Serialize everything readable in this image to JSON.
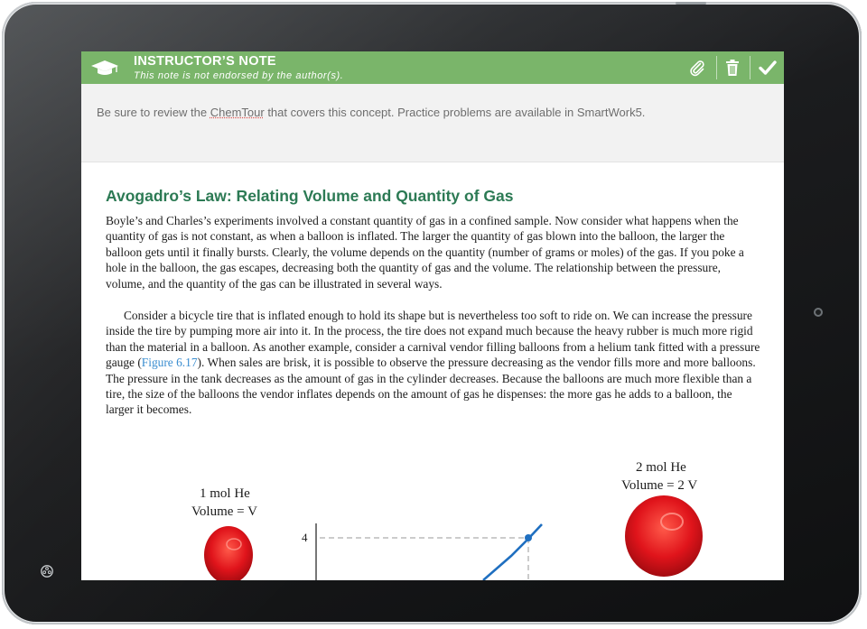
{
  "note": {
    "title": "INSTRUCTOR’S NOTE",
    "subtitle": "This note is not endorsed by the author(s).",
    "body_before": "Be sure to review the ",
    "body_link": "ChemTour",
    "body_after": " that covers this concept. Practice problems are available in SmartWork5.",
    "header_color": "#7ab56a",
    "icons": {
      "cap": "graduation-cap-icon",
      "attach": "paperclip-icon",
      "delete": "trash-icon",
      "confirm": "checkmark-icon"
    }
  },
  "section": {
    "heading": "Avogadro’s Law: Relating Volume and Quantity of Gas",
    "heading_color": "#2c7a54",
    "paragraph1": "Boyle’s and Charles’s experiments involved a constant quantity of gas in a confined sample. Now consider what happens when the quantity of gas is not constant, as when a balloon is inflated. The larger the quantity of gas blown into the balloon, the larger the balloon gets until it finally bursts. Clearly, the volume depends on the quantity (number of grams or moles) of the gas. If you poke a hole in the balloon, the gas escapes, decreasing both the quantity of gas and the volume. The relationship between the pressure, volume, and the quantity of the gas can be illustrated in several ways.",
    "paragraph2_before": "Consider a bicycle tire that is inflated enough to hold its shape but is nevertheless too soft to ride on. We can increase the pressure inside the tire by pumping more air into it. In the process, the tire does not expand much because the heavy rubber is much more rigid than the material in a balloon. As another example, consider a carnival vendor filling balloons from a helium tank fitted with a pressure gauge (",
    "paragraph2_link": "Figure 6.17",
    "paragraph2_after": "). When sales are brisk, it is possible to observe the pressure decreasing as the vendor fills more and more balloons. The pressure in the tank decreases as the amount of gas in the cylinder decreases. Because the balloons are much more flexible than a tire, the size of the balloons the vendor inflates depends on the amount of gas he dispenses: the more gas he adds to a balloon, the larger it becomes."
  },
  "figure": {
    "left_label_line1": "1 mol He",
    "left_label_line2": "Volume = V",
    "right_label_line1": "2 mol He",
    "right_label_line2": "Volume = 2 V",
    "axis_tick": "4",
    "line_color": "#1f6fc0",
    "balloon_color": "#e0141b"
  }
}
